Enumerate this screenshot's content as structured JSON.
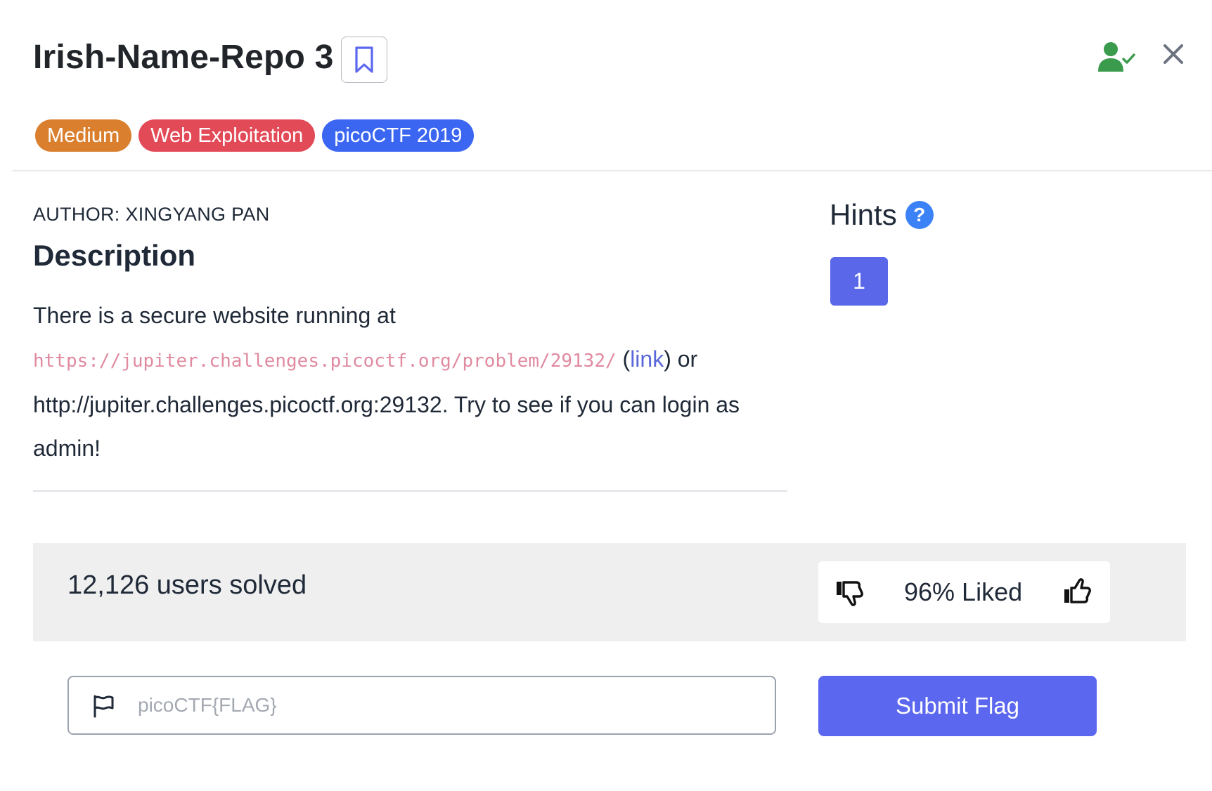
{
  "challenge": {
    "title": "Irish-Name-Repo 3",
    "tags": [
      "Medium",
      "Web Exploitation",
      "picoCTF 2019"
    ],
    "author": "AUTHOR: XINGYANG PAN",
    "description_heading": "Description",
    "description": {
      "text_before": "There is a secure website running at ",
      "code_url": "https://jupiter.challenges.picoctf.org/problem/29132/",
      "paren_open": " (",
      "link_text": "link",
      "text_after": ") or http://jupiter.challenges.picoctf.org:29132. Try to see if you can login as admin!"
    }
  },
  "hints": {
    "title": "Hints",
    "help_glyph": "?",
    "buttons": [
      "1"
    ]
  },
  "stats": {
    "solved": "12,126 users solved",
    "liked": "96% Liked"
  },
  "flag_form": {
    "placeholder": "picoCTF{FLAG}",
    "submit_label": "Submit Flag"
  },
  "colors": {
    "accent": "#5b67ee",
    "medium_tag": "#d97f2d",
    "category_tag": "#e34a57",
    "event_tag": "#3b66f2",
    "user_check": "#3a9b4c"
  },
  "icons": [
    "bookmark-icon",
    "user-check-icon",
    "close-icon",
    "help-icon",
    "thumbs-down-icon",
    "thumbs-up-icon",
    "flag-icon"
  ]
}
